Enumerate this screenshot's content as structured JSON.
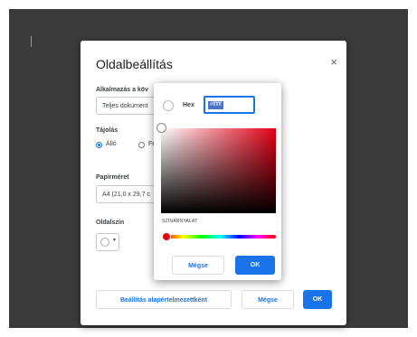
{
  "dialog": {
    "title": "Oldalbeállítás",
    "close_glyph": "×",
    "apply_label": "Alkalmazás a köv",
    "apply_value": "Teljes dokument",
    "orientation_label": "Tájolás",
    "orientation_options": [
      "Álló",
      "Fe"
    ],
    "paper_label": "Papírméret",
    "paper_value": "A4 (21,0 x 29,7 c",
    "page_color_label": "Oldalszín",
    "default_button": "Beállítás alapértelmezettként",
    "cancel_button": "Mégse",
    "ok_button": "OK"
  },
  "picker": {
    "hex_label": "Hex",
    "hex_value": "#ffffff",
    "hue_label": "SZÍNÁRNYALAT",
    "cancel_button": "Mégse",
    "ok_button": "OK"
  },
  "colors": {
    "accent": "#1a73e8",
    "backdrop": "#3a3a3a",
    "selected_hue": "#e30016"
  },
  "icons": {
    "close": "close-icon",
    "dropdown": "chevron-down-icon"
  }
}
